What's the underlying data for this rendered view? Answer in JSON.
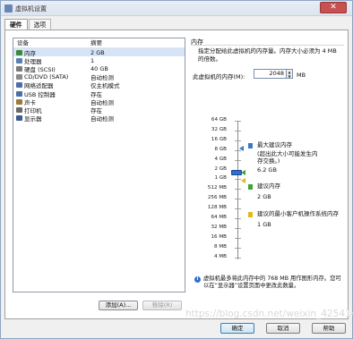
{
  "window": {
    "title": "虚拟机设置",
    "close_glyph": "✕"
  },
  "tabs": [
    {
      "label": "硬件"
    },
    {
      "label": "选项"
    }
  ],
  "device_list": {
    "headers": {
      "device": "设备",
      "summary": "摘要"
    },
    "rows": [
      {
        "name": "内存",
        "summary": "2 GB",
        "icon": "memory-icon",
        "color": "#3b8a3b"
      },
      {
        "name": "处理器",
        "summary": "1",
        "icon": "cpu-icon",
        "color": "#5a7fb0"
      },
      {
        "name": "硬盘 (SCSI)",
        "summary": "40 GB",
        "icon": "hard-disk-icon",
        "color": "#7a7a7a"
      },
      {
        "name": "CD/DVD (SATA)",
        "summary": "自动检测",
        "icon": "cd-dvd-icon",
        "color": "#8a8a8a"
      },
      {
        "name": "网络适配器",
        "summary": "仅主机模式",
        "icon": "network-adapter-icon",
        "color": "#4a6fa8"
      },
      {
        "name": "USB 控制器",
        "summary": "存在",
        "icon": "usb-icon",
        "color": "#4a6fa8"
      },
      {
        "name": "声卡",
        "summary": "自动检测",
        "icon": "sound-card-icon",
        "color": "#9a7a3a"
      },
      {
        "name": "打印机",
        "summary": "存在",
        "icon": "printer-icon",
        "color": "#6a6a6a"
      },
      {
        "name": "显示器",
        "summary": "自动检测",
        "icon": "display-icon",
        "color": "#3a5a90"
      }
    ],
    "buttons": {
      "add": "添加(A)...",
      "remove": "移除(R)"
    }
  },
  "memory": {
    "group_title": "内存",
    "description": "指定分配给此虚拟机的内存量。内存大小必须为 4 MB 的倍数。",
    "field_label": "此虚拟机的内存(M):",
    "value": "2048",
    "unit": "MB",
    "scale": [
      "64 GB",
      "32 GB",
      "16 GB",
      "8 GB",
      "4 GB",
      "2 GB",
      "1 GB",
      "512 MB",
      "256 MB",
      "128 MB",
      "64 MB",
      "32 MB",
      "16 MB",
      "8 MB",
      "4 MB"
    ],
    "legend": {
      "max": {
        "title": "最大建议内存",
        "note": "(超出此大小可能发生内存交换。)",
        "value": "6.2 GB",
        "color": "#3c78c8"
      },
      "recommended": {
        "title": "建议内存",
        "value": "2 GB",
        "color": "#3aa63a"
      },
      "min": {
        "title": "建议的最小客户机操作系统内存",
        "value": "1 GB",
        "color": "#e3b722"
      }
    },
    "info": "虚拟机最多将此内存中的 768 MB 用作图形内存。您可以在“显示器”设置页面中更改此数量。"
  },
  "footer": {
    "ok": "确定",
    "cancel": "取消",
    "help": "帮助"
  },
  "watermark": "https://blog.csdn.net/weixin_42541461"
}
